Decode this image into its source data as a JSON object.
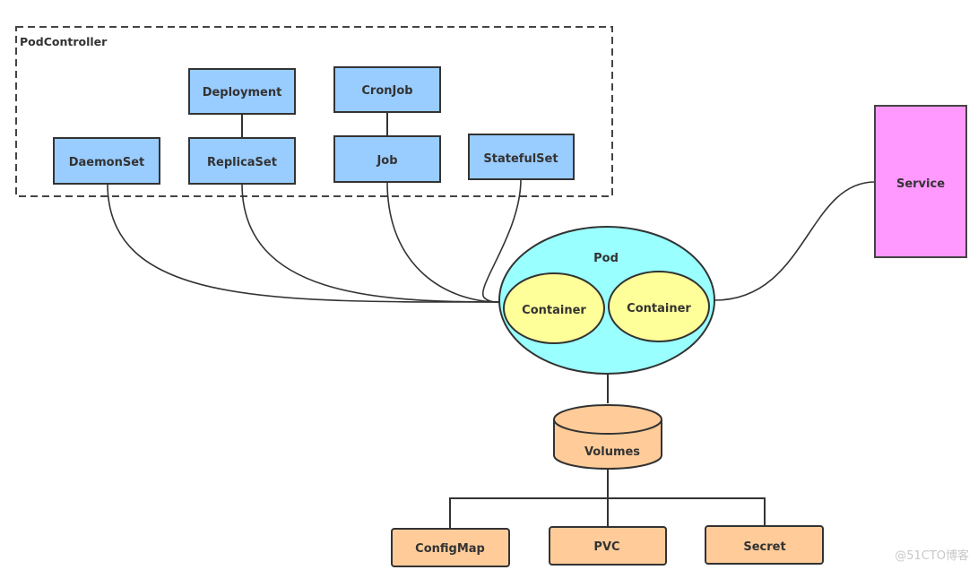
{
  "diagram": {
    "group": {
      "label": "PodController"
    },
    "controllers": [
      {
        "id": "deployment",
        "label": "Deployment"
      },
      {
        "id": "cronjob",
        "label": "CronJob"
      },
      {
        "id": "daemonset",
        "label": "DaemonSet"
      },
      {
        "id": "replicaset",
        "label": "ReplicaSet"
      },
      {
        "id": "job",
        "label": "Job"
      },
      {
        "id": "statefulset",
        "label": "StatefulSet"
      }
    ],
    "pod": {
      "label": "Pod",
      "containers": [
        {
          "label": "Container"
        },
        {
          "label": "Container"
        }
      ]
    },
    "service": {
      "label": "Service"
    },
    "volumes": {
      "label": "Volumes"
    },
    "volume_types": [
      {
        "id": "configmap",
        "label": "ConfigMap"
      },
      {
        "id": "pvc",
        "label": "PVC"
      },
      {
        "id": "secret",
        "label": "Secret"
      }
    ],
    "colors": {
      "controller_fill": "#99ccff",
      "pod_fill": "#99ffff",
      "container_fill": "#ffff99",
      "service_fill": "#ff99ff",
      "volume_fill": "#ffcc99",
      "stroke": "#333333"
    }
  },
  "watermark": "@51CTO博客"
}
